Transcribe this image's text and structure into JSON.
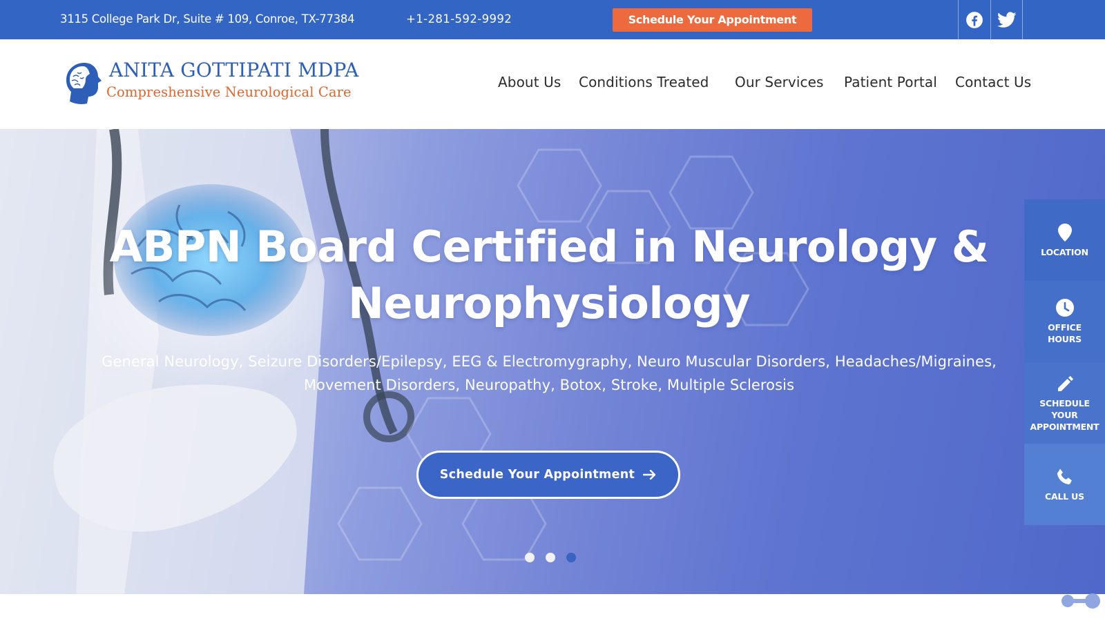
{
  "topbar": {
    "address": "3115 College Park Dr, Suite # 109, Conroe, TX-77384",
    "phone": "+1-281-592-9992",
    "schedule_label": "Schedule Your Appointment",
    "social": [
      "facebook-icon",
      "twitter-icon"
    ],
    "colors": {
      "bar": "#3366c4",
      "cta": "#ec6a3e"
    }
  },
  "header": {
    "logo_title": "ANITA GOTTIPATI MDPA",
    "logo_subtitle": "Compreshensive Neurological Care",
    "nav": [
      "About Us",
      "Conditions Treated",
      "Our Services",
      "Patient Portal",
      "Contact Us"
    ]
  },
  "hero": {
    "title_line1": "ABPN Board Certified in Neurology &",
    "title_line2": "Neurophysiology",
    "subtitle_line1": "General Neurology, Seizure Disorders/Epilepsy, EEG & Electromygraphy, Neuro Muscular Disorders, Headaches/Migraines,",
    "subtitle_line2": "Movement Disorders, Neuropathy, Botox, Stroke, Multiple Sclerosis",
    "button_label": "Schedule Your Appointment",
    "button_icon": "arrow-right-icon",
    "slides": 3,
    "active_slide": 3
  },
  "sidebar": {
    "items": [
      {
        "icon": "location-pin-icon",
        "lines": [
          "LOCATION"
        ]
      },
      {
        "icon": "clock-icon",
        "lines": [
          "OFFICE",
          "HOURS"
        ]
      },
      {
        "icon": "pencil-icon",
        "lines": [
          "SCHEDULE",
          "YOUR",
          "APPOINTMENT"
        ]
      },
      {
        "icon": "phone-icon",
        "lines": [
          "CALL US"
        ]
      }
    ]
  }
}
